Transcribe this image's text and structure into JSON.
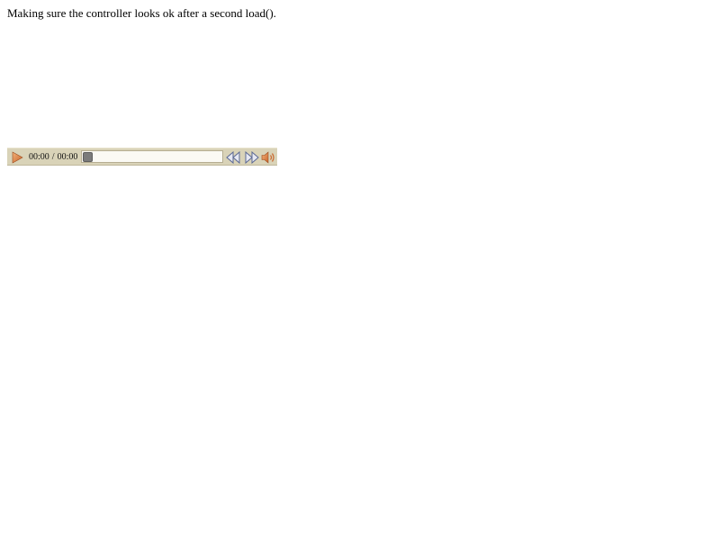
{
  "caption": "Making sure the controller looks ok after a second load().",
  "player": {
    "current_time": "00:00",
    "separator": "/",
    "duration": "00:00",
    "progress": 0,
    "icons": {
      "play": "play-icon",
      "rewind": "rewind-icon",
      "fast_forward": "fast-forward-icon",
      "volume": "volume-icon"
    },
    "colors": {
      "bar_background": "#d9d3b8",
      "play_icon": "#e0884a",
      "volume_icon": "#e0884a",
      "seek_icons": "#6b7aa8",
      "thumb": "#7b7b7b"
    }
  }
}
